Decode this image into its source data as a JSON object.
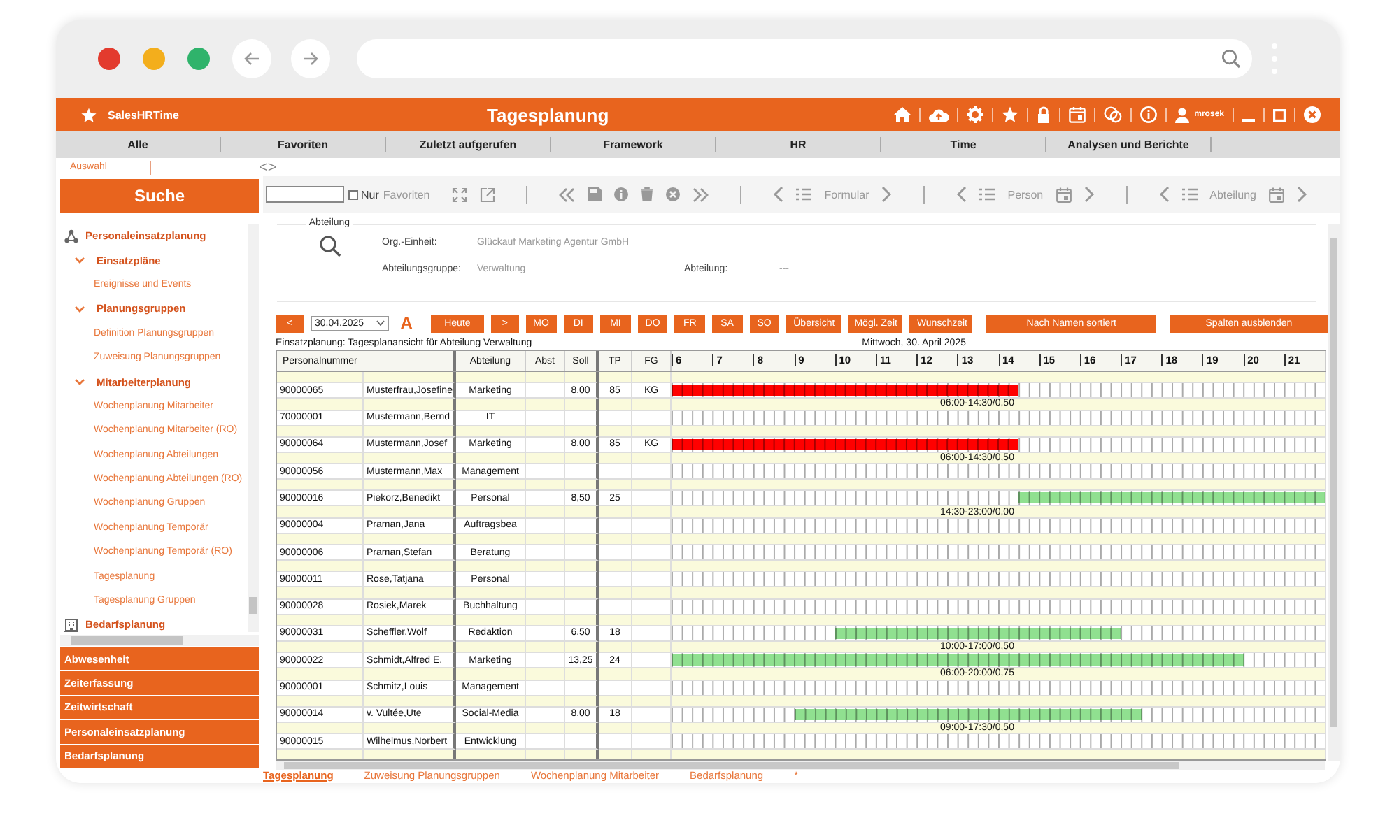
{
  "app": {
    "brand": "SalesHRTime",
    "title": "Tagesplanung",
    "user": "mrosek"
  },
  "menu": [
    "Alle",
    "Favoriten",
    "Zuletzt aufgerufen",
    "Framework",
    "HR",
    "Time",
    "Analysen und Berichte"
  ],
  "selection_tab": "Auswahl",
  "history_nav": "<>",
  "sidebar": {
    "search_button": "Suche",
    "tree": [
      {
        "label": "Personaleinsatzplanung",
        "kind": "hierarchy",
        "children": [
          {
            "label": "Einsatzpläne",
            "expanded": true,
            "children": [
              {
                "label": "Ereignisse und Events"
              }
            ]
          },
          {
            "label": "Planungsgruppen",
            "expanded": true,
            "children": [
              {
                "label": "Definition Planungsgruppen"
              },
              {
                "label": "Zuweisung Planungsgruppen"
              }
            ]
          },
          {
            "label": "Mitarbeiterplanung",
            "expanded": true,
            "children": [
              {
                "label": "Wochenplanung Mitarbeiter"
              },
              {
                "label": "Wochenplanung Mitarbeiter (RO)"
              },
              {
                "label": "Wochenplanung Abteilungen"
              },
              {
                "label": "Wochenplanung Abteilungen (RO)"
              },
              {
                "label": "Wochenplanung Gruppen"
              },
              {
                "label": "Wochenplanung Temporär"
              },
              {
                "label": "Wochenplanung Temporär (RO)"
              },
              {
                "label": "Tagesplanung"
              },
              {
                "label": "Tagesplanung Gruppen"
              }
            ]
          }
        ]
      },
      {
        "label": "Bedarfsplanung",
        "kind": "building"
      }
    ],
    "sections": [
      "Abwesenheit",
      "Zeiterfassung",
      "Zeitwirtschaft",
      "Personaleinsatzplanung",
      "Bedarfsplanung"
    ]
  },
  "toolbar": {
    "favorites_only": {
      "label": "Nur",
      "hint": "Favoriten",
      "checked": false
    },
    "navigators": [
      {
        "label": "Formular",
        "kind": "plain"
      },
      {
        "label": "Person",
        "kind": "calendar"
      },
      {
        "label": "Abteilung",
        "kind": "calendar"
      }
    ]
  },
  "department_form": {
    "legend": "Abteilung",
    "fields": [
      {
        "label": "Org.-Einheit:",
        "value": "Glückauf Marketing Agentur GmbH"
      },
      {
        "label": "Abteilungsgruppe:",
        "value": "Verwaltung"
      },
      {
        "label": "Abteilung:",
        "value": "---"
      }
    ]
  },
  "controls": {
    "prev": "<",
    "date": "30.04.2025",
    "mode": "A",
    "today": "Heute",
    "next": ">",
    "weekdays": [
      "MO",
      "DI",
      "MI",
      "DO",
      "FR",
      "SA",
      "SO"
    ],
    "views": [
      "Übersicht",
      "Mögl. Zeit",
      "Wunschzeit"
    ],
    "sort": "Nach Namen sortiert",
    "hide_columns": "Spalten ausblenden"
  },
  "plan": {
    "caption": "Einsatzplanung: Tagesplanansicht für Abteilung Verwaltung",
    "date": "Mittwoch, 30. April 2025",
    "columns": [
      "Personalnummer",
      "Abteilung",
      "Abst",
      "Soll",
      "TP",
      "FG"
    ],
    "hours": [
      "6",
      "7",
      "8",
      "9",
      "10",
      "11",
      "12",
      "13",
      "14",
      "15",
      "16",
      "17",
      "18",
      "19",
      "20",
      "21"
    ],
    "employees": [
      {
        "number": "90000065",
        "name": "Musterfrau,Josefine",
        "department": "Marketing",
        "soll": "8,00",
        "tp": "85",
        "fg": "KG",
        "shift": {
          "label": "06:00-14:30/0,50",
          "color": "#ff0000"
        }
      },
      {
        "number": "70000001",
        "name": "Mustermann,Bernd",
        "department": "IT"
      },
      {
        "number": "90000064",
        "name": "Mustermann,Josef",
        "department": "Marketing",
        "soll": "8,00",
        "tp": "85",
        "fg": "KG",
        "shift": {
          "label": "06:00-14:30/0,50",
          "color": "#ff0000"
        }
      },
      {
        "number": "90000056",
        "name": "Mustermann,Max",
        "department": "Management"
      },
      {
        "number": "90000016",
        "name": "Piekorz,Benedikt",
        "department": "Personal",
        "soll": "8,50",
        "tp": "25",
        "shift": {
          "label": "14:30-23:00/0,00",
          "color": "#90e090"
        }
      },
      {
        "number": "90000004",
        "name": "Praman,Jana",
        "department": "Auftragsbea"
      },
      {
        "number": "90000006",
        "name": "Praman,Stefan",
        "department": "Beratung"
      },
      {
        "number": "90000011",
        "name": "Rose,Tatjana",
        "department": "Personal"
      },
      {
        "number": "90000028",
        "name": "Rosiek,Marek",
        "department": "Buchhaltung"
      },
      {
        "number": "90000031",
        "name": "Scheffler,Wolf",
        "department": "Redaktion",
        "soll": "6,50",
        "tp": "18",
        "shift": {
          "label": "10:00-17:00/0,50",
          "color": "#90e090"
        }
      },
      {
        "number": "90000022",
        "name": "Schmidt,Alfred E.",
        "department": "Marketing",
        "soll": "13,25",
        "tp": "24",
        "shift": {
          "label": "06:00-20:00/0,75",
          "color": "#90e090"
        }
      },
      {
        "number": "90000001",
        "name": "Schmitz,Louis",
        "department": "Management"
      },
      {
        "number": "90000014",
        "name": "v. Vultée,Ute",
        "department": "Social-Media",
        "soll": "8,00",
        "tp": "18",
        "shift": {
          "label": "09:00-17:30/0,50",
          "color": "#90e090"
        }
      },
      {
        "number": "90000015",
        "name": "Wilhelmus,Norbert",
        "department": "Entwicklung"
      }
    ]
  },
  "bottom_tabs": [
    {
      "label": "Tagesplanung",
      "selected": true
    },
    {
      "label": "Zuweisung Planungsgruppen",
      "selected": false
    },
    {
      "label": "Wochenplanung Mitarbeiter",
      "selected": false
    },
    {
      "label": "Bedarfsplanung",
      "selected": false
    },
    {
      "label": "*",
      "selected": false
    }
  ]
}
